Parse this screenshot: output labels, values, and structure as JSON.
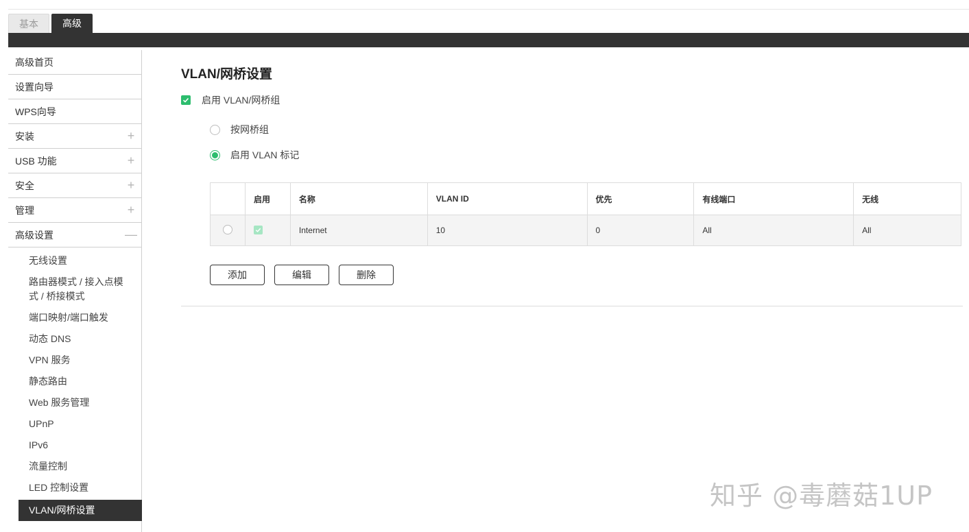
{
  "tabs": [
    {
      "label": "基本"
    },
    {
      "label": "高级"
    }
  ],
  "sidebar": {
    "items": [
      {
        "label": "高级首页",
        "sign": ""
      },
      {
        "label": "设置向导",
        "sign": ""
      },
      {
        "label": "WPS向导",
        "sign": ""
      },
      {
        "label": "安装",
        "sign": "+"
      },
      {
        "label": "USB 功能",
        "sign": "+"
      },
      {
        "label": "安全",
        "sign": "+"
      },
      {
        "label": "管理",
        "sign": "+"
      },
      {
        "label": "高级设置",
        "sign": "—"
      }
    ],
    "sub_items": [
      {
        "label": "无线设置"
      },
      {
        "label": "路由器模式 / 接入点模式 / 桥接模式"
      },
      {
        "label": "端口映射/端口触发"
      },
      {
        "label": "动态 DNS"
      },
      {
        "label": "VPN 服务"
      },
      {
        "label": "静态路由"
      },
      {
        "label": "Web 服务管理"
      },
      {
        "label": "UPnP"
      },
      {
        "label": "IPv6"
      },
      {
        "label": "流量控制"
      },
      {
        "label": "LED 控制设置"
      },
      {
        "label": "VLAN/网桥设置"
      }
    ]
  },
  "main": {
    "title": "VLAN/网桥设置",
    "enable_label": "启用 VLAN/网桥组",
    "radio_bridge_label": "按网桥组",
    "radio_vlan_label": "启用 VLAN 标记",
    "table": {
      "headers": [
        "",
        "启用",
        "名称",
        "VLAN ID",
        "优先",
        "有线端口",
        "无线"
      ],
      "rows": [
        {
          "name": "Internet",
          "vlan_id": "10",
          "priority": "0",
          "wired": "All",
          "wireless": "All"
        }
      ]
    },
    "buttons": {
      "add": "添加",
      "edit": "编辑",
      "delete": "删除"
    }
  },
  "watermark": "知乎 @毒蘑菇1UP",
  "colors": {
    "accent": "#2dbd6e",
    "dark": "#333333"
  }
}
